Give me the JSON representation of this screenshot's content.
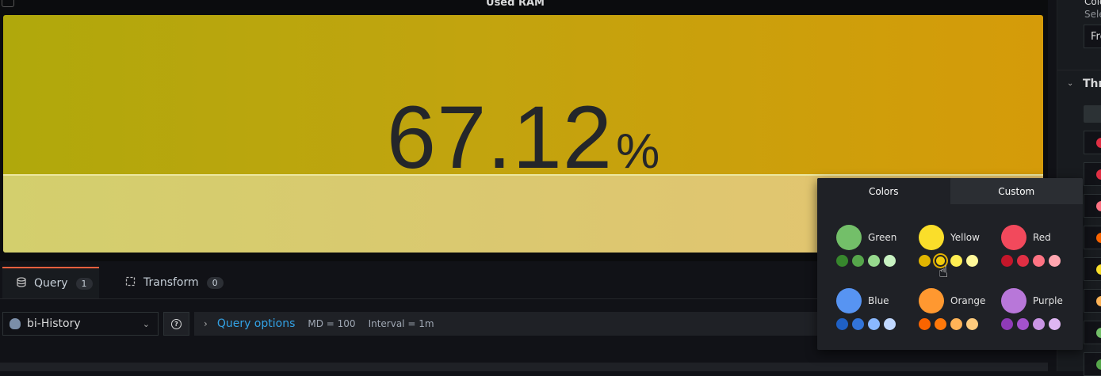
{
  "panel": {
    "title": "Used RAM",
    "value": "67.12",
    "unit": "%"
  },
  "tabs": [
    {
      "label": "Query",
      "count": "1",
      "icon": "database-icon"
    },
    {
      "label": "Transform",
      "count": "0",
      "icon": "transform-icon"
    }
  ],
  "query_row": {
    "datasource": "bi-History",
    "options_label": "Query options",
    "md": "MD = 100",
    "interval": "Interval = 1m"
  },
  "right_panel": {
    "color_label": "Colo",
    "color_sub": "Sele",
    "mode_value": "Fre",
    "thresholds_label": "Thre",
    "threshold_colors": [
      "#e02f44",
      "#e02f44",
      "#ff7383",
      "#fa6400",
      "#fade2a",
      "#ffb357",
      "#73bf69",
      "#56a64b"
    ]
  },
  "picker": {
    "tab_colors": "Colors",
    "tab_custom": "Custom",
    "groups": [
      {
        "name": "Green",
        "main": "#73bf69",
        "shades": [
          "#37872d",
          "#56a64b",
          "#96d98d",
          "#c8f2c2"
        ]
      },
      {
        "name": "Yellow",
        "main": "#fade2a",
        "shades": [
          "#e0b400",
          "#f2cc0c",
          "#ffee52",
          "#fff899"
        ],
        "selected": 1
      },
      {
        "name": "Red",
        "main": "#f2495c",
        "shades": [
          "#c4162a",
          "#e02f44",
          "#ff7383",
          "#ffa6b0"
        ]
      },
      {
        "name": "Blue",
        "main": "#5794f2",
        "shades": [
          "#1f60c4",
          "#3274d9",
          "#8ab8ff",
          "#c0d8ff"
        ]
      },
      {
        "name": "Orange",
        "main": "#ff9830",
        "shades": [
          "#fa6400",
          "#ff780a",
          "#ffb357",
          "#ffcb7d"
        ]
      },
      {
        "name": "Purple",
        "main": "#b877d9",
        "shades": [
          "#8f3bb8",
          "#a352cc",
          "#ca95e5",
          "#deb6f2"
        ]
      }
    ]
  }
}
